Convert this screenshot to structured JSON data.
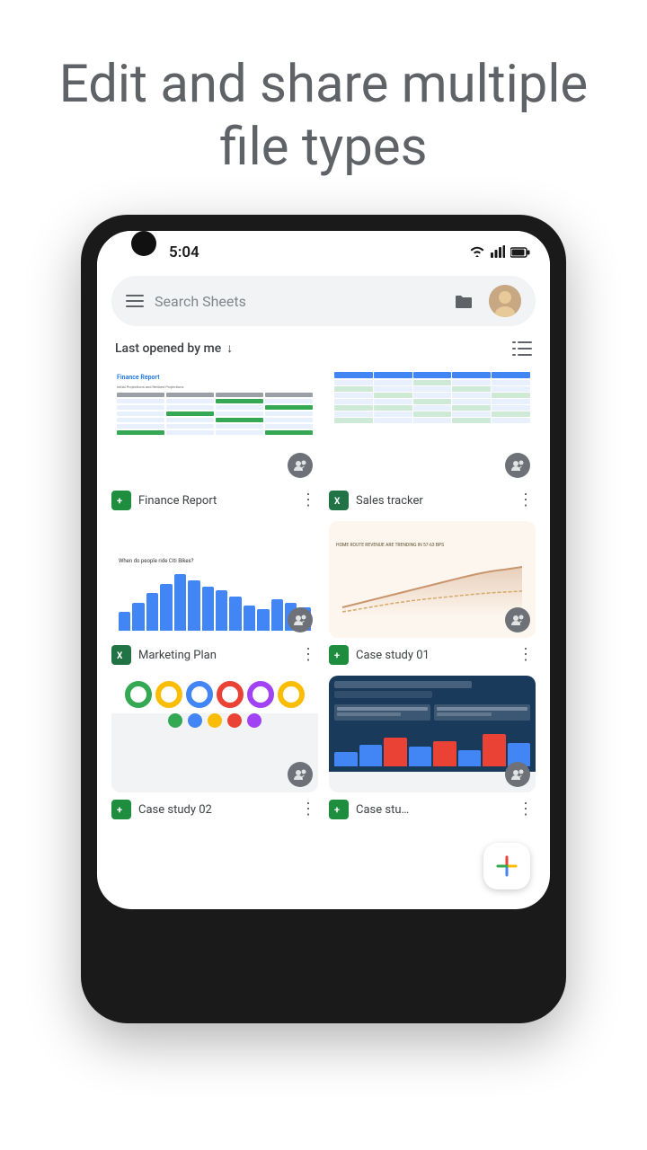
{
  "page": {
    "title_line1": "Edit and share multiple",
    "title_line2": "file types"
  },
  "statusBar": {
    "time": "5:04"
  },
  "searchBar": {
    "placeholder": "Search Sheets"
  },
  "sortBar": {
    "label": "Last opened by me",
    "arrow": "↓"
  },
  "files": [
    {
      "id": "finance-report",
      "name": "Finance Report",
      "type": "sheets",
      "typeIcon": "+"
    },
    {
      "id": "sales-tracker",
      "name": "Sales tracker",
      "type": "excel",
      "typeIcon": "X"
    },
    {
      "id": "marketing-plan",
      "name": "Marketing Plan",
      "type": "excel",
      "typeIcon": "X"
    },
    {
      "id": "case-study-01",
      "name": "Case study 01",
      "type": "sheets",
      "typeIcon": "+"
    },
    {
      "id": "case-study-02",
      "name": "Case study 02",
      "type": "sheets",
      "typeIcon": "+"
    },
    {
      "id": "case-study-03",
      "name": "Case stu…",
      "type": "sheets",
      "typeIcon": "+"
    }
  ],
  "fab": {
    "label": "+"
  },
  "colors": {
    "sheetsGreen": "#1e8e3e",
    "excelGreen": "#217346",
    "accent": "#4285f4"
  }
}
